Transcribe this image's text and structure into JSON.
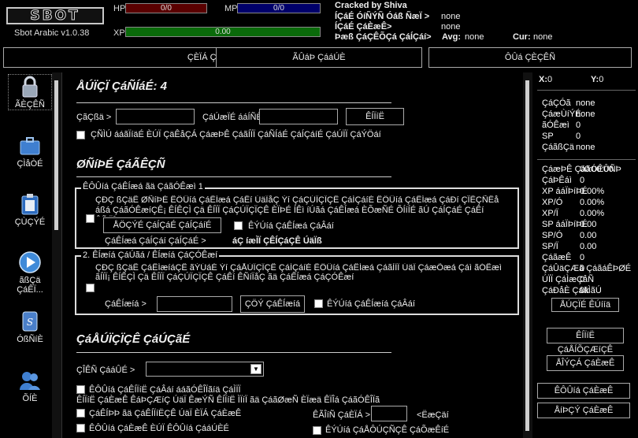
{
  "app": {
    "logo": "SBOT",
    "version": "Sbot Arabic v1.0.38"
  },
  "bars": {
    "hp_label": "HP",
    "hp_value": "0/0",
    "mp_label": "MP",
    "mp_value": "0/0",
    "xp_label": "XP",
    "xp_value": "0.00"
  },
  "header_info": {
    "cracked": "Cracked by Shiva",
    "line1_label": "ÍÇáÉ ÓíÑÝÑ Óáß ÑæÏ  >",
    "line1_value": "none",
    "line2_label": "ÍÇáÉ ÇáÈæÊ>",
    "line2_value": "none",
    "line3_label": "Þæß ÇáÇÊÕÇá ÇáÍÇáí>",
    "line3_value": "none",
    "avg_label": "Avg:",
    "avg_value": "none",
    "cur_label": "Cur:",
    "cur_value": "none"
  },
  "top_tabs": [
    "ÇÈÏÁ ÇááÚÈ",
    "ÃÛáÞ ÇááÚÈ",
    "ÔÛá ÇÈÇÊÑ"
  ],
  "nav": [
    {
      "label": "ÃÈÇÊÑ",
      "icon": "lock-icon"
    },
    {
      "label": "ÇÌåÒÉ",
      "icon": "briefcase-icon"
    },
    {
      "label": "ÇÙÇÝÉ",
      "icon": "clipboard-icon"
    },
    {
      "label": "ãßÇä ÇáÊÏ...",
      "icon": "play-icon"
    },
    {
      "label": "ÓßÑíÈ",
      "icon": "script-icon"
    },
    {
      "label": "ÕÍÈ",
      "icon": "users-icon"
    }
  ],
  "main": {
    "section1_title": "ÅÚÏÇÏ ÇáÑÍáÉ: 4",
    "field_place_label": "ÇãÇßä >",
    "field_return_label": "ÇáÚæÏÉ ááÍÑÈ >",
    "field_place_value": "",
    "field_return_value": "",
    "check_btn": "ÊÍÏíË",
    "option1": "ÇÑÌÚ ááãÏíäÉ ÈÚÏ ÇäÊåÇÁ ÇáæÞÊ ÇáãÍÏÏ ÇáÑÍáÉ ÇáÍÇáíÉ ÇáÚÏÏ ÇáÝÖáí",
    "section2_title": "ØÑíÞÉ ÇáÃÊÇÑ",
    "group1_legend": "ÊÔÛíá ÇáÊÍæá ãä ÇáãÓÊæì 1",
    "group1_text": "ÇÐÇ ßÇäÊ ØÑíÞÉ ÊÔÛíá ÇáÊÍæá ÇáÊí ÚäÏåÇ Ýí ÇáÇÚÏÇÏÇÊ ÇáÍÇáíÉ ÊÔÛíá ÇáÊÍæá ÇáÐí ÇÎÊÇÑÊå áßá ÇáãÓÊæíÇÊ¡ ÊÍÊÇÌ Çä ÊÍÏÏ ÇáÇÚÏÇÏÇÊ ÈÏÞÉ ÍÊì íÚãá ÇáÊÍæá ÈÕæÑÉ ÕÍíÍÉ ãÚ ÇáÍÇáÉ ÇáÊí ÊÑíÏåÇ",
    "group1_btn": "ÅÖÇÝÉ ÇáÍÇáÉ ÇáÍÇáíÉ ááÊÍæá",
    "group1_check": "ÊÝÚíá ÇáÊÍæá ÇáÂáí",
    "group1_sub_label": "ÇáÊÍæá ÇáÍÇáí ÇáÍÇáÉ >",
    "group1_sub_value": "áÇ íæÌÏ ÇÊÍÇáÇÊ ÚäÏß",
    "group2_legend": "2. ÊÍæíá ÇáÚãá / ÊÍæíá ÇáÇÓÊæí",
    "group2_text": "ÇÐÇ ßÇäÊ ÇáÊÍæíáÇÊ ãÝÚáÉ Ýí ÇáÅÚÏÇÏÇÊ ÇáÍÇáíÉ ÊÔÛíá ÇáÊÍæá ÇáãÍÏÏ ÚäÏ ÇáæÕæá Çáì ãÓÊæì ãÍÏÏ¡ ÊÍÊÇÌ Çä ÊÍÏÏ ÇáÇÚÏÇÏÇÊ ÇáÊí ÊÑíÏåÇ ãä ÇáÊÍæá ÇáÇÓÊæí",
    "group2_sub_label": "ÇáÊÍæíá >",
    "group2_sub_value": "",
    "group2_btn": "ÇÖÝ ÇáÊÍæíá",
    "group2_check": "ÊÝÚíá ÇáÊÍæíá ÇáÂáí",
    "section3_title": "ÇáÅÚÏÇÏÇÊ ÇáÚÇãÉ",
    "lang_label": "ÇÎÊÑ ÇááÛÉ  >",
    "lang_value": "",
    "opt_a": "ÊÔÛíá ÇáÊÍÏíË ÇáÂáí ááãÓÊÎÏãíä ÇáÌÏÏ",
    "opt_a_desc": "ÊÍÏíË ÇáÈæÊ ÊáÞÇÆíÇ ÚäÏ ÊæÝÑ ÊÍÏíË ÌÏíÏ ãä ÇáãØæÑ ÈÏæä ÊÏÎá ÇáãÓÊÎÏã",
    "opt_b": "ÇáÊÍÞÞ ãä ÇáÊÍÏíËÇÊ ÚäÏ ÈÏÁ ÇáÈæÊ",
    "opt_c": "ÊÔÛíá ÇáÈæÊ ÈÚÏ ÊÔÛíá ÇááÚÈÉ",
    "delay_label": "ÊÃÎíÑ ÇáÈÏÁ  >",
    "delay_value": "",
    "delay_unit": "<ËæÇäí",
    "opt_d": "ÊÝÚíá ÇáÅÔÚÇÑÇÊ ÇáÕæÊíÉ"
  },
  "right": {
    "x_label": "X:",
    "x_value": "0",
    "y_label": "Y:",
    "y_value": "0",
    "stats1": [
      {
        "label": "ÇáÇÓã",
        "value": "none"
      },
      {
        "label": "ÇáæÙíÝÉ",
        "value": "none"
      },
      {
        "label": "ãÓÊæì",
        "value": "0"
      },
      {
        "label": "SP",
        "value": "0"
      },
      {
        "label": "ÇáãßÇä",
        "value": "none"
      }
    ],
    "stats2": [
      {
        "label": "ÇáæÞÊ ÇáãÓÊÛÑÞ",
        "value": "00:00:00"
      },
      {
        "label": "ÇáÞÊáì",
        "value": "0"
      },
      {
        "label": "XP ááÏÞíÞÉ",
        "value": "0.00%"
      },
      {
        "label": "XP/Ó",
        "value": "0.00%"
      },
      {
        "label": "XP/Ï",
        "value": "0.00%"
      },
      {
        "label": "SP ááÏÞíÞÉ",
        "value": "0.00"
      },
      {
        "label": "SP/Ó",
        "value": "0.00"
      },
      {
        "label": "SP/Ï",
        "value": "0.00"
      },
      {
        "label": "ÇáãæÊ",
        "value": "0"
      },
      {
        "label": "ÇáÛäÇÆã ÇáãáÊÞØÉ",
        "value": "0"
      },
      {
        "label": "ÚÏÏ ÇáÌæÇåÑ",
        "value": "0"
      },
      {
        "label": "ÇáÐåÈ ÇáãÌãÚ",
        "value": "0k"
      }
    ],
    "btn_reset": "ÅÚÇÏÉ ÊÚííä",
    "btn_show_xp": "ÊÍÏíË ÇáÅÍÕÇÆíÇÊ",
    "btn_hide": "ÅÎÝÇÁ ÇáÈæÊ",
    "btn_start": "ÊÔÛíá ÇáÈæÊ",
    "btn_stop": "ÅíÞÇÝ ÇáÈæÊ"
  }
}
